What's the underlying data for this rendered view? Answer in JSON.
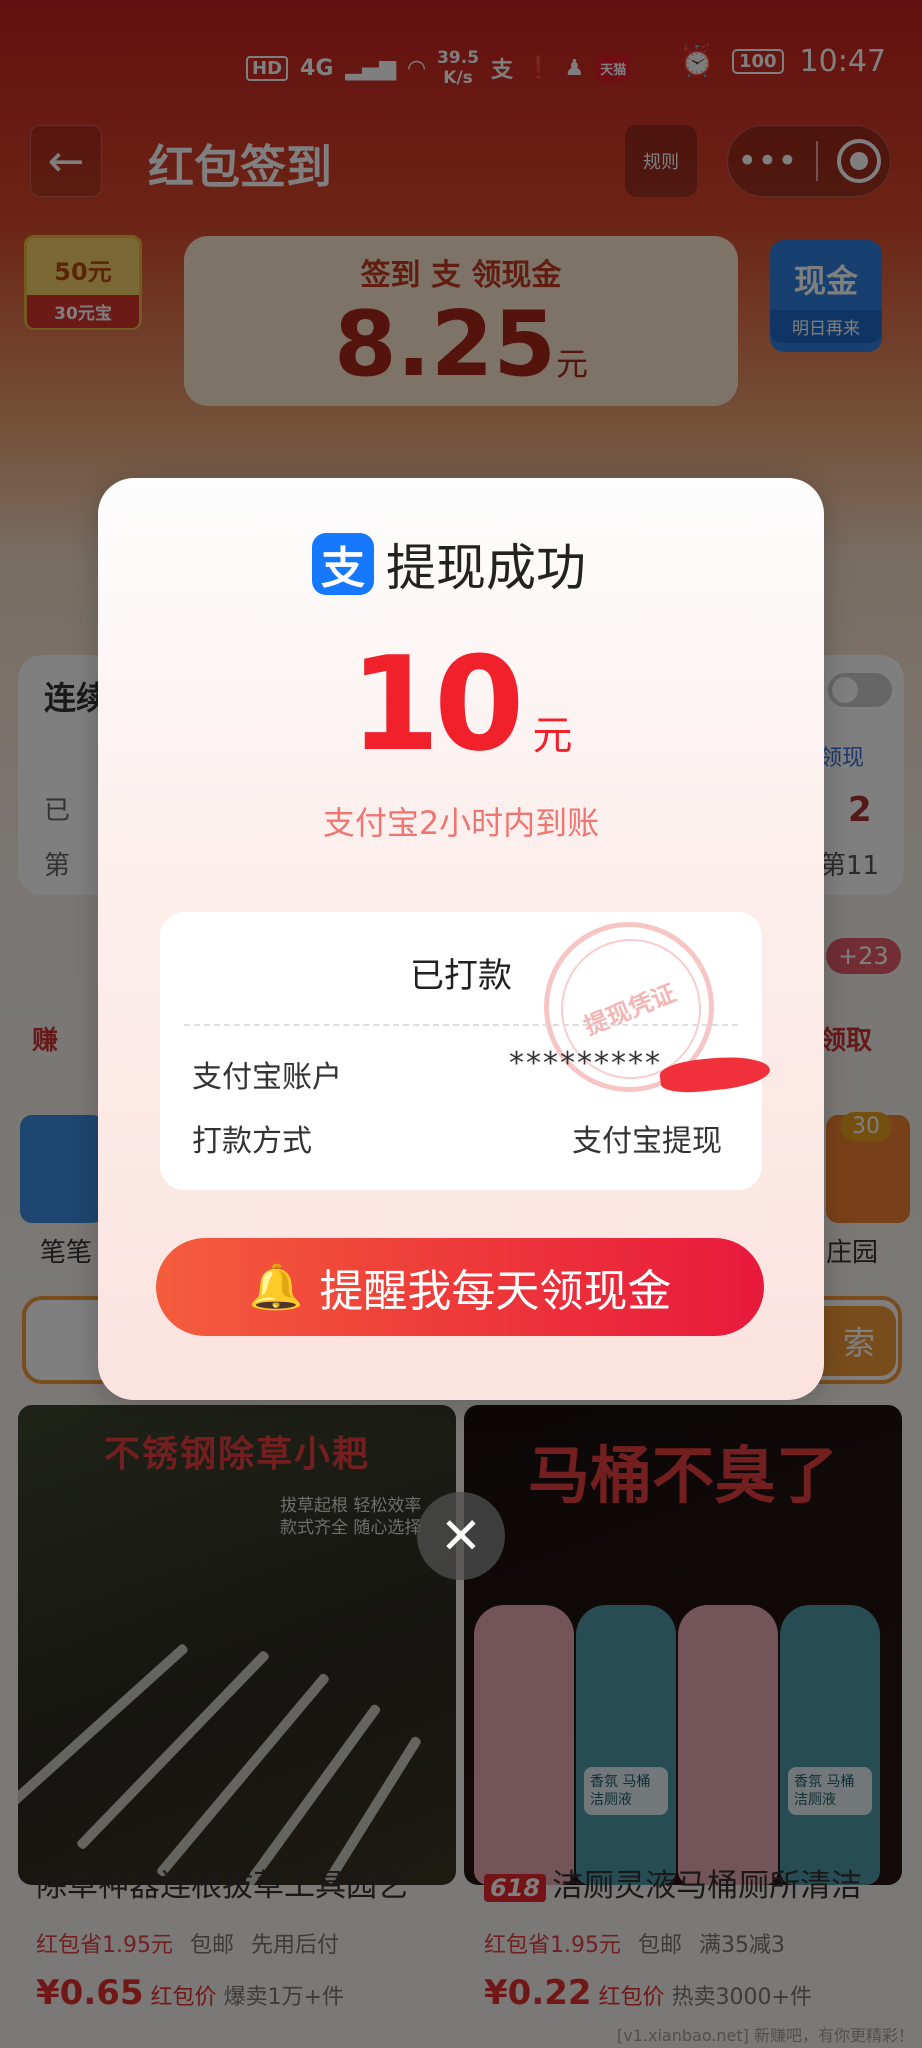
{
  "status_bar": {
    "network_hd": "HD",
    "network_4g": "4G",
    "speed_value": "39.5",
    "speed_unit": "K/s",
    "alipay_glyph": "支",
    "tmall_label": "天猫",
    "battery": "100",
    "time": "10:47"
  },
  "nav": {
    "title": "红包签到",
    "rules_label": "规则",
    "more_glyph": "•••"
  },
  "background": {
    "coupon_big": "50元",
    "coupon_small": "30元宝",
    "hero_subtitle": "签到 支 领现金",
    "hero_amount": "8.25",
    "hero_unit": "元",
    "cash_chip_big": "现金",
    "cash_chip_small": "明日再来",
    "section_title": "连续",
    "left_1": "已",
    "left_2": "第",
    "right_num": "2",
    "right_day": "第11",
    "right_lingxian": "领现",
    "earn_label": "赚",
    "claim_label": "领取",
    "badge_23": "+23",
    "badge_30": "30",
    "tile_left_label": "笔笔",
    "tile_right_label": "庄园",
    "search_button": "索"
  },
  "products": [
    {
      "headline": "不锈钢除草小耙",
      "sub_line_1": "拔草起根 轻松效率",
      "sub_line_2": "款式齐全 随心选择",
      "name": "除草神器连根拔草工具园艺",
      "save": "红包省1.95元",
      "shipping": "包邮",
      "extra": "先用后付",
      "price": "¥0.65",
      "price_label": "红包价",
      "sales": "爆卖1万+件"
    },
    {
      "headline": "马桶不臭了",
      "tag": "618",
      "bottle_label": "香氛 马桶洁厕液",
      "name": "洁厕灵液马桶厕所清洁",
      "save": "红包省1.95元",
      "shipping": "包邮",
      "extra": "满35减3",
      "price": "¥0.22",
      "price_label": "红包价",
      "sales": "热卖3000+件"
    }
  ],
  "watermark": "[v1.xianbao.net] 新赚吧，有你更精彩！",
  "modal": {
    "logo_glyph": "支",
    "title": "提现成功",
    "amount": "10",
    "unit": "元",
    "arrival_note": "支付宝2小时内到账",
    "status": "已打款",
    "stamp_text": "提现凭证",
    "account_label": "支付宝账户",
    "account_value": "*********",
    "method_label": "打款方式",
    "method_value": "支付宝提现",
    "remind_button": "提醒我每天领现金",
    "close_glyph": "✕"
  },
  "colors": {
    "accent_red": "#f1212b",
    "alipay_blue": "#1677ff",
    "button_gradient_start": "#f45d3c",
    "button_gradient_end": "#e8193c"
  }
}
